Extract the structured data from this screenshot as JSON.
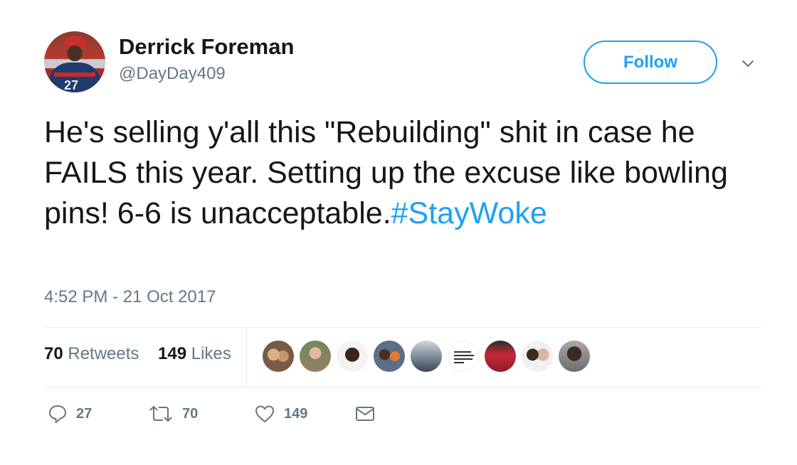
{
  "author": {
    "name": "Derrick Foreman",
    "handle": "@DayDay409",
    "avatar_jersey_number": "27"
  },
  "follow_label": "Follow",
  "tweet": {
    "text": "He's selling y'all this \"Rebuilding\" shit in case he FAILS this year. Setting up the excuse like bowling pins! 6-6 is unacceptable.",
    "hashtag": "#StayWoke",
    "timestamp": "4:52 PM - 21 Oct 2017"
  },
  "stats": {
    "retweets_count": "70",
    "retweets_label": "Retweets",
    "likes_count": "149",
    "likes_label": "Likes"
  },
  "liker_avatars_count": 9,
  "actions": {
    "reply_count": "27",
    "retweet_count": "70",
    "like_count": "149"
  },
  "colors": {
    "accent": "#1da1f2",
    "secondary_text": "#657786",
    "primary_text": "#14171a",
    "divider": "#e6ecf0"
  },
  "icons": [
    "chevron-down-icon",
    "reply-icon",
    "retweet-icon",
    "heart-icon",
    "envelope-icon"
  ]
}
